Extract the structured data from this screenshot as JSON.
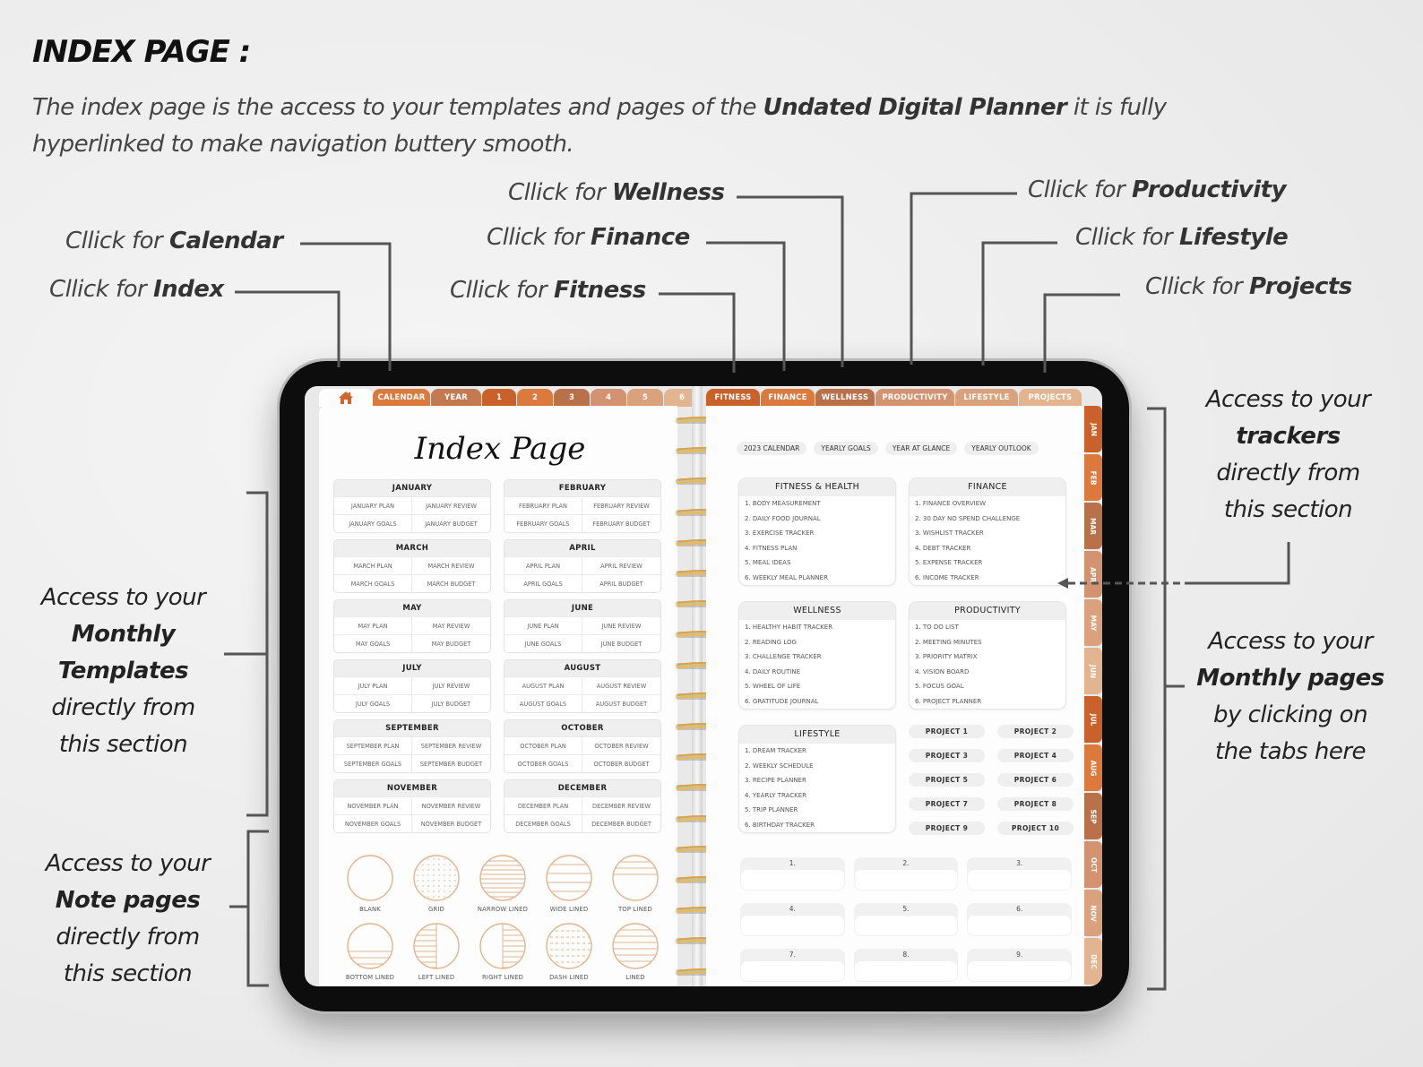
{
  "header": {
    "title": "INDEX PAGE :",
    "intro_part1": "The index page is the access to your templates and pages of the ",
    "intro_bold": "Undated Digital Planner",
    "intro_part2": " it is fully hyperlinked to make navigation buttery smooth."
  },
  "callouts": [
    {
      "prefix": "Cllick for ",
      "bold": "Wellness"
    },
    {
      "prefix": "Cllick for ",
      "bold": "Productivity"
    },
    {
      "prefix": "Cllick for ",
      "bold": "Calendar"
    },
    {
      "prefix": "Cllick for ",
      "bold": "Finance"
    },
    {
      "prefix": "Cllick for ",
      "bold": "Lifestyle"
    },
    {
      "prefix": "Cllick for ",
      "bold": "Index"
    },
    {
      "prefix": "Cllick for ",
      "bold": "Fitness"
    },
    {
      "prefix": "Cllick for ",
      "bold": "Projects"
    }
  ],
  "side_notes": {
    "monthly_templates": {
      "line1": "Access to your",
      "bold1": "Monthly",
      "bold2": "Templates",
      "line3": "directly from",
      "line4": "this section"
    },
    "note_pages": {
      "line1": "Access to your",
      "bold1": "Note pages",
      "line3": "directly from",
      "line4": "this section"
    },
    "trackers": {
      "line1": "Access to your",
      "bold1": "trackers",
      "line3": "directly from",
      "line4": "this section"
    },
    "monthly_pages": {
      "line1": "Access to your",
      "bold1": "Monthly pages",
      "line3": "by clicking on",
      "line4": "the tabs here"
    }
  },
  "colors": {
    "tab_dark": "#c8622a",
    "tab_mid": "#dc7a3e",
    "tab_brown": "#b9714a",
    "tab_light": "#d99b72",
    "tab_pale": "#e2b48f",
    "note_stroke": "#e0b58e",
    "ring_gold": "#d9a441"
  },
  "planner": {
    "top_tabs_left": [
      {
        "label": "CALENDAR",
        "color": "#dc7a3e"
      },
      {
        "label": "YEAR",
        "color": "#c47a50"
      },
      {
        "label": "1",
        "color": "#c8622a"
      },
      {
        "label": "2",
        "color": "#dc7a3e"
      },
      {
        "label": "3",
        "color": "#b9714a"
      },
      {
        "label": "4",
        "color": "#d49370"
      },
      {
        "label": "5",
        "color": "#d9a27c"
      },
      {
        "label": "6",
        "color": "#e2b48f"
      }
    ],
    "top_tabs_right": [
      {
        "label": "FITNESS",
        "color": "#c8622a"
      },
      {
        "label": "FINANCE",
        "color": "#dc7a3e"
      },
      {
        "label": "WELLNESS",
        "color": "#b9714a"
      },
      {
        "label": "PRODUCTIVITY",
        "color": "#d49370"
      },
      {
        "label": "LIFESTYLE",
        "color": "#d9a27c"
      },
      {
        "label": "PROJECTS",
        "color": "#e2b48f"
      }
    ],
    "side_tabs": [
      {
        "label": "JAN",
        "color": "#c8622a"
      },
      {
        "label": "FEB",
        "color": "#dc7a3e"
      },
      {
        "label": "MAR",
        "color": "#b9714a"
      },
      {
        "label": "APR",
        "color": "#d49370"
      },
      {
        "label": "MAY",
        "color": "#d9a27c"
      },
      {
        "label": "JUN",
        "color": "#e2b48f"
      },
      {
        "label": "JUL",
        "color": "#c8622a"
      },
      {
        "label": "AUG",
        "color": "#dc7a3e"
      },
      {
        "label": "SEP",
        "color": "#b9714a"
      },
      {
        "label": "OCT",
        "color": "#d49370"
      },
      {
        "label": "NOV",
        "color": "#d9a27c"
      },
      {
        "label": "DEC",
        "color": "#e2b48f"
      }
    ],
    "index_title": "Index Page",
    "months": [
      {
        "name": "JANUARY",
        "cells": [
          "JANUARY PLAN",
          "JANUARY REVIEW",
          "JANUARY GOALS",
          "JANUARY BUDGET"
        ]
      },
      {
        "name": "FEBRUARY",
        "cells": [
          "FEBRUARY PLAN",
          "FEBRUARY REVIEW",
          "FEBRUARY GOALS",
          "FEBRUARY BUDGET"
        ]
      },
      {
        "name": "MARCH",
        "cells": [
          "MARCH PLAN",
          "MARCH REVIEW",
          "MARCH GOALS",
          "MARCH BUDGET"
        ]
      },
      {
        "name": "APRIL",
        "cells": [
          "APRIL PLAN",
          "APRIL REVIEW",
          "APRIL GOALS",
          "APRIL BUDGET"
        ]
      },
      {
        "name": "MAY",
        "cells": [
          "MAY PLAN",
          "MAY REVIEW",
          "MAY GOALS",
          "MAY BUDGET"
        ]
      },
      {
        "name": "JUNE",
        "cells": [
          "JUNE PLAN",
          "JUNE REVIEW",
          "JUNE GOALS",
          "JUNE BUDGET"
        ]
      },
      {
        "name": "JULY",
        "cells": [
          "JULY PLAN",
          "JULY REVIEW",
          "JULY GOALS",
          "JULY BUDGET"
        ]
      },
      {
        "name": "AUGUST",
        "cells": [
          "AUGUST PLAN",
          "AUGUST REVIEW",
          "AUGUST GOALS",
          "AUGUST BUDGET"
        ]
      },
      {
        "name": "SEPTEMBER",
        "cells": [
          "SEPTEMBER PLAN",
          "SEPTEMBER REVIEW",
          "SEPTEMBER GOALS",
          "SEPTEMBER BUDGET"
        ]
      },
      {
        "name": "OCTOBER",
        "cells": [
          "OCTOBER PLAN",
          "OCTOBER REVIEW",
          "OCTOBER GOALS",
          "OCTOBER BUDGET"
        ]
      },
      {
        "name": "NOVEMBER",
        "cells": [
          "NOVEMBER PLAN",
          "NOVEMBER REVIEW",
          "NOVEMBER GOALS",
          "NOVEMBER BUDGET"
        ]
      },
      {
        "name": "DECEMBER",
        "cells": [
          "DECEMBER PLAN",
          "DECEMBER REVIEW",
          "DECEMBER GOALS",
          "DECEMBER BUDGET"
        ]
      }
    ],
    "note_templates": [
      {
        "label": "BLANK",
        "pattern": "blank"
      },
      {
        "label": "GRID",
        "pattern": "dots"
      },
      {
        "label": "NARROW LINED",
        "pattern": "narrow"
      },
      {
        "label": "WIDE LINED",
        "pattern": "wide"
      },
      {
        "label": "TOP LINED",
        "pattern": "top"
      },
      {
        "label": "BOTTOM LINED",
        "pattern": "bottom"
      },
      {
        "label": "LEFT LINED",
        "pattern": "left"
      },
      {
        "label": "RIGHT LINED",
        "pattern": "right"
      },
      {
        "label": "DASH LINED",
        "pattern": "dash"
      },
      {
        "label": "LINED",
        "pattern": "lined"
      }
    ],
    "quick_links": [
      "2023 CALENDAR",
      "YEARLY GOALS",
      "YEAR AT GLANCE",
      "YEARLY OUTLOOK"
    ],
    "categories": [
      {
        "title": "FITNESS & HEALTH",
        "items": [
          "1. BODY MEASUREMENT",
          "2. DAILY FOOD JOURNAL",
          "3. EXERCISE TRACKER",
          "4. FITNESS PLAN",
          "5. MEAL IDEAS",
          "6. WEEKLY MEAL PLANNER"
        ]
      },
      {
        "title": "FINANCE",
        "items": [
          "1. FINANCE OVERVIEW",
          "2. 30 DAY NO SPEND CHALLENGE",
          "3. WISHLIST TRACKER",
          "4. DEBT TRACKER",
          "5. EXPENSE TRACKER",
          "6. INCOME TRACKER"
        ]
      },
      {
        "title": "WELLNESS",
        "items": [
          "1. HEALTHY HABIT TRACKER",
          "2. READING LOG",
          "3. CHALLENGE TRACKER",
          "4. DAILY ROUTINE",
          "5. WHEEL OF LIFE",
          "6. GRATITUDE JOURNAL"
        ]
      },
      {
        "title": "PRODUCTIVITY",
        "items": [
          "1. TO DO LIST",
          "2. MEETING MINUTES",
          "3. PRIORITY MATRIX",
          "4. VISION BOARD",
          "5. FOCUS GOAL",
          "6. PROJECT PLANNER"
        ]
      },
      {
        "title": "LIFESTYLE",
        "items": [
          "1. DREAM TRACKER",
          "2. WEEKLY SCHEDULE",
          "3. RECIPE PLANNER",
          "4. YEARLY TRACKER",
          "5. TRIP PLANNER",
          "6. BIRTHDAY TRACKER"
        ]
      }
    ],
    "projects": [
      "PROJECT 1",
      "PROJECT 2",
      "PROJECT 3",
      "PROJECT 4",
      "PROJECT 5",
      "PROJECT 6",
      "PROJECT 7",
      "PROJECT 8",
      "PROJECT 9",
      "PROJECT 10"
    ],
    "numbered_boxes": [
      "1.",
      "2.",
      "3.",
      "4.",
      "5.",
      "6.",
      "7.",
      "8.",
      "9."
    ]
  }
}
